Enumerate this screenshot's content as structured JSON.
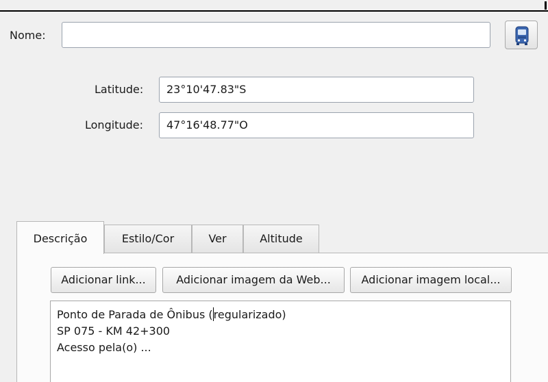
{
  "form": {
    "name_label": "Nome:",
    "name_value": "",
    "latitude_label": "Latitude:",
    "latitude_value": "23°10'47.83\"S",
    "longitude_label": "Longitude:",
    "longitude_value": "47°16'48.77\"O"
  },
  "icons": {
    "placemark_button": "bus-icon"
  },
  "tabs": [
    {
      "label": "Descrição",
      "active": true
    },
    {
      "label": "Estilo/Cor",
      "active": false
    },
    {
      "label": "Ver",
      "active": false
    },
    {
      "label": "Altitude",
      "active": false
    }
  ],
  "toolbar": {
    "add_link": "Adicionar link...",
    "add_web_image": "Adicionar imagem da Web...",
    "add_local_image": "Adicionar imagem local..."
  },
  "description": {
    "line1_before_caret": "Ponto de Parada de Ônibus (",
    "line1_after_caret": "regularizado)",
    "line2": "SP 075 - KM 42+300",
    "line3": "Acesso pela(o) ..."
  },
  "colors": {
    "window_bg": "#f0f0f0",
    "bus_icon": "#3c67b0"
  }
}
